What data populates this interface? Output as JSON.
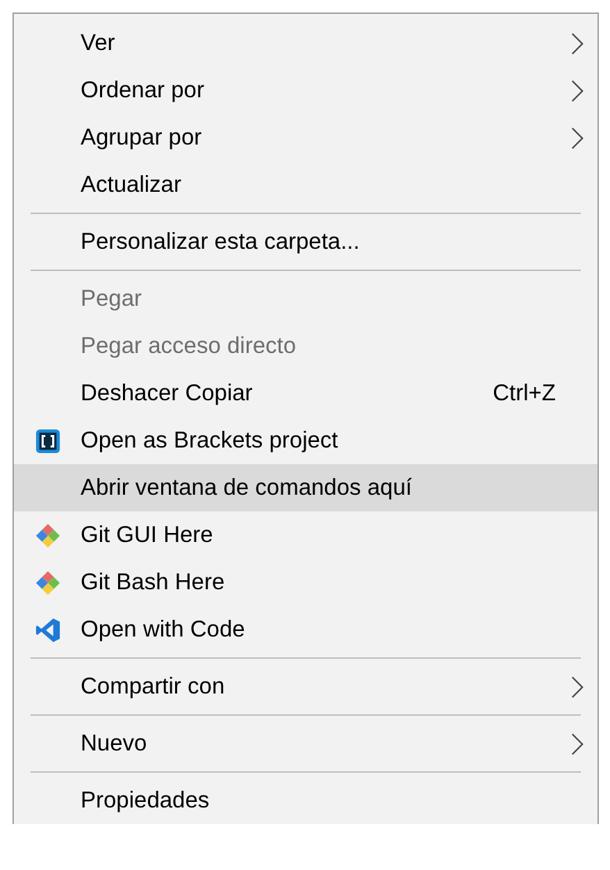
{
  "context_menu": {
    "groups": [
      {
        "items": [
          {
            "label": "Ver",
            "kind": "plain",
            "submenu": true,
            "disabled": false,
            "selected": false
          },
          {
            "label": "Ordenar por",
            "kind": "plain",
            "submenu": true,
            "disabled": false,
            "selected": false
          },
          {
            "label": "Agrupar por",
            "kind": "plain",
            "submenu": true,
            "disabled": false,
            "selected": false
          },
          {
            "label": "Actualizar",
            "kind": "plain",
            "submenu": false,
            "disabled": false,
            "selected": false
          }
        ]
      },
      {
        "items": [
          {
            "label": "Personalizar esta carpeta...",
            "kind": "plain",
            "submenu": false,
            "disabled": false,
            "selected": false
          }
        ]
      },
      {
        "items": [
          {
            "label": "Pegar",
            "kind": "plain",
            "submenu": false,
            "disabled": true,
            "selected": false
          },
          {
            "label": "Pegar acceso directo",
            "kind": "plain",
            "submenu": false,
            "disabled": true,
            "selected": false
          },
          {
            "label": "Deshacer Copiar",
            "kind": "plain",
            "submenu": false,
            "disabled": false,
            "selected": false,
            "shortcut": "Ctrl+Z"
          },
          {
            "label": "Open as Brackets project",
            "kind": "brackets",
            "submenu": false,
            "disabled": false,
            "selected": false
          },
          {
            "label": "Abrir ventana de comandos aquí",
            "kind": "plain",
            "submenu": false,
            "disabled": false,
            "selected": true
          },
          {
            "label": "Git GUI Here",
            "kind": "git",
            "submenu": false,
            "disabled": false,
            "selected": false
          },
          {
            "label": "Git Bash Here",
            "kind": "git",
            "submenu": false,
            "disabled": false,
            "selected": false
          },
          {
            "label": "Open with Code",
            "kind": "code",
            "submenu": false,
            "disabled": false,
            "selected": false
          }
        ]
      },
      {
        "items": [
          {
            "label": "Compartir con",
            "kind": "plain",
            "submenu": true,
            "disabled": false,
            "selected": false
          }
        ]
      },
      {
        "items": [
          {
            "label": "Nuevo",
            "kind": "plain",
            "submenu": true,
            "disabled": false,
            "selected": false
          }
        ]
      },
      {
        "items": [
          {
            "label": "Propiedades",
            "kind": "plain",
            "submenu": false,
            "disabled": false,
            "selected": false
          }
        ]
      }
    ]
  }
}
